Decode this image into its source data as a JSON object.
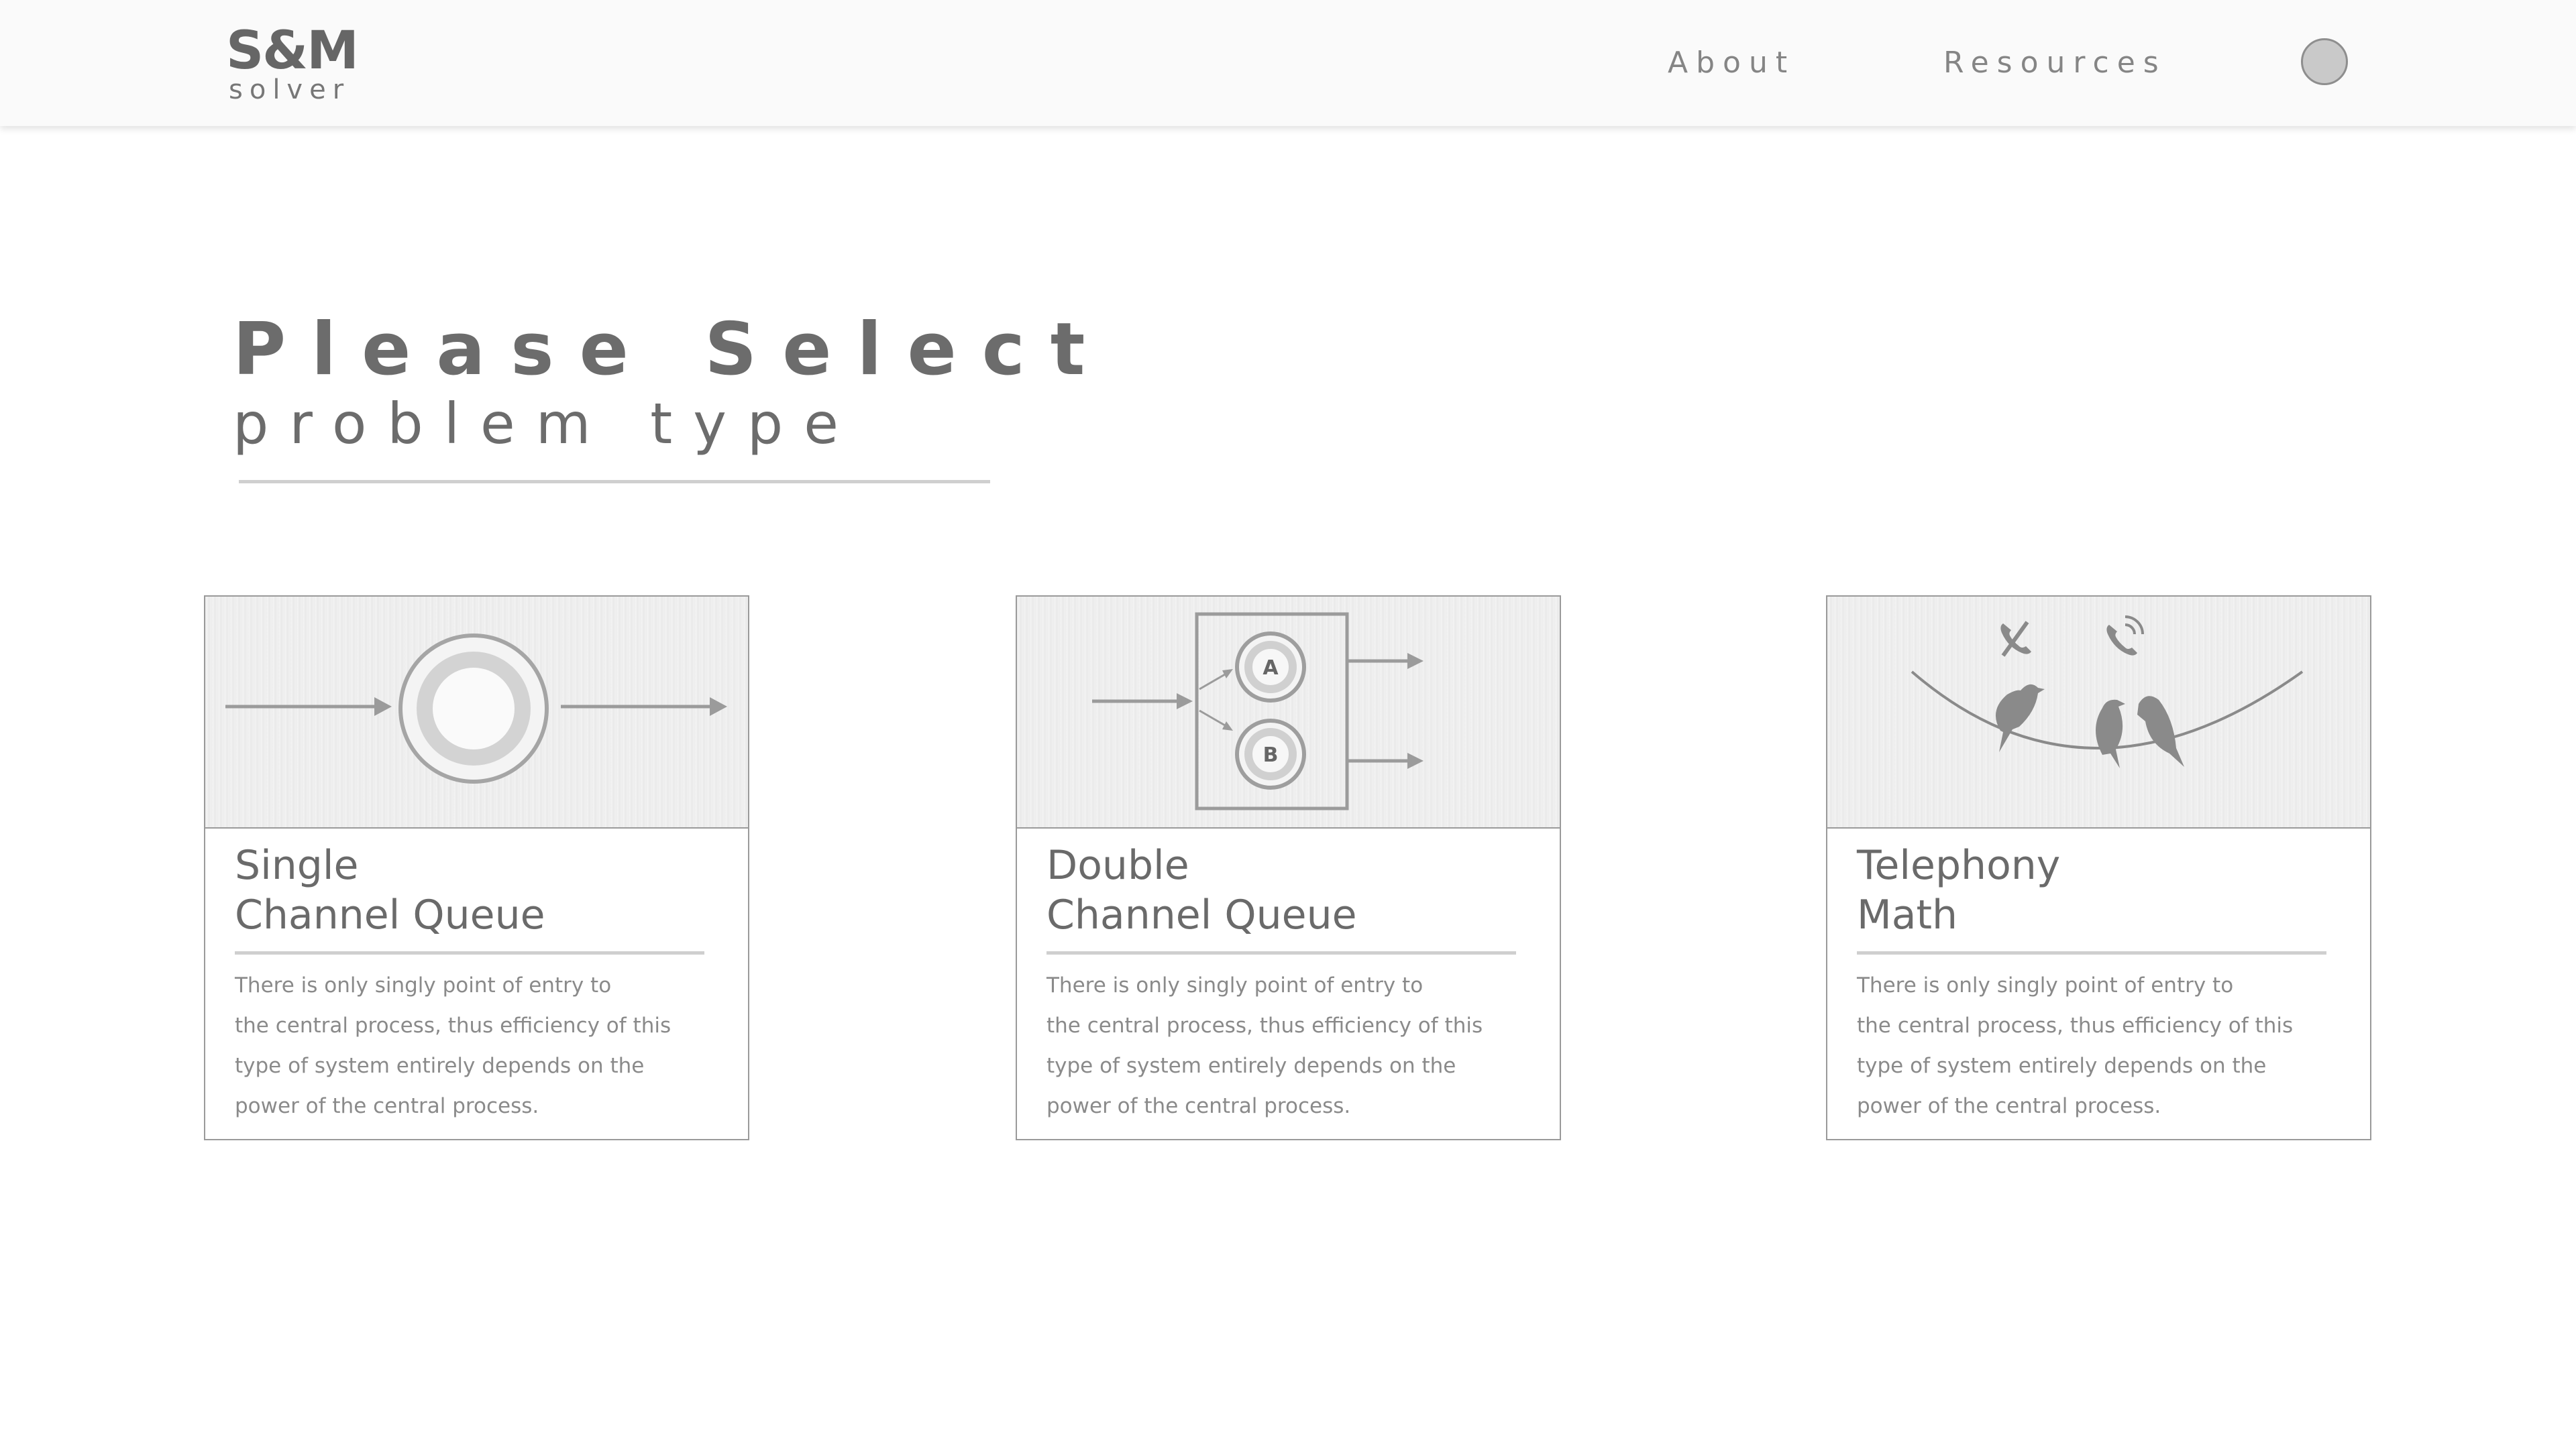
{
  "nav": {
    "logo_main": "S&M",
    "logo_sub": "solver",
    "links": [
      "About",
      "Resources"
    ]
  },
  "hero": {
    "title": "Please Select",
    "subtitle": "problem type"
  },
  "cards": [
    {
      "title": "Single\nChannel Queue",
      "description": "There is only singly point of entry to\nthe central process, thus efficiency of this\ntype of system entirely depends on the\npower of the central process.",
      "image": "single-channel-diagram"
    },
    {
      "title": "Double\nChannel Queue",
      "description": "There is only singly point of entry to\nthe central process, thus efficiency of this\ntype of system entirely depends on the\npower of the central process.",
      "image": "double-channel-diagram",
      "server_labels": [
        "A",
        "B"
      ]
    },
    {
      "title": "Telephony\nMath",
      "description": "There is only singly point of entry to\nthe central process, thus efficiency of this\ntype of system entirely depends on the\npower of the central process.",
      "image": "birds-on-wire-telephony"
    }
  ],
  "colors": {
    "text": "#6b6b6b",
    "muted": "#8a8a8a",
    "rule": "#cfcfcf",
    "border": "#9a9a9a",
    "nav_bg": "#fafafa"
  }
}
